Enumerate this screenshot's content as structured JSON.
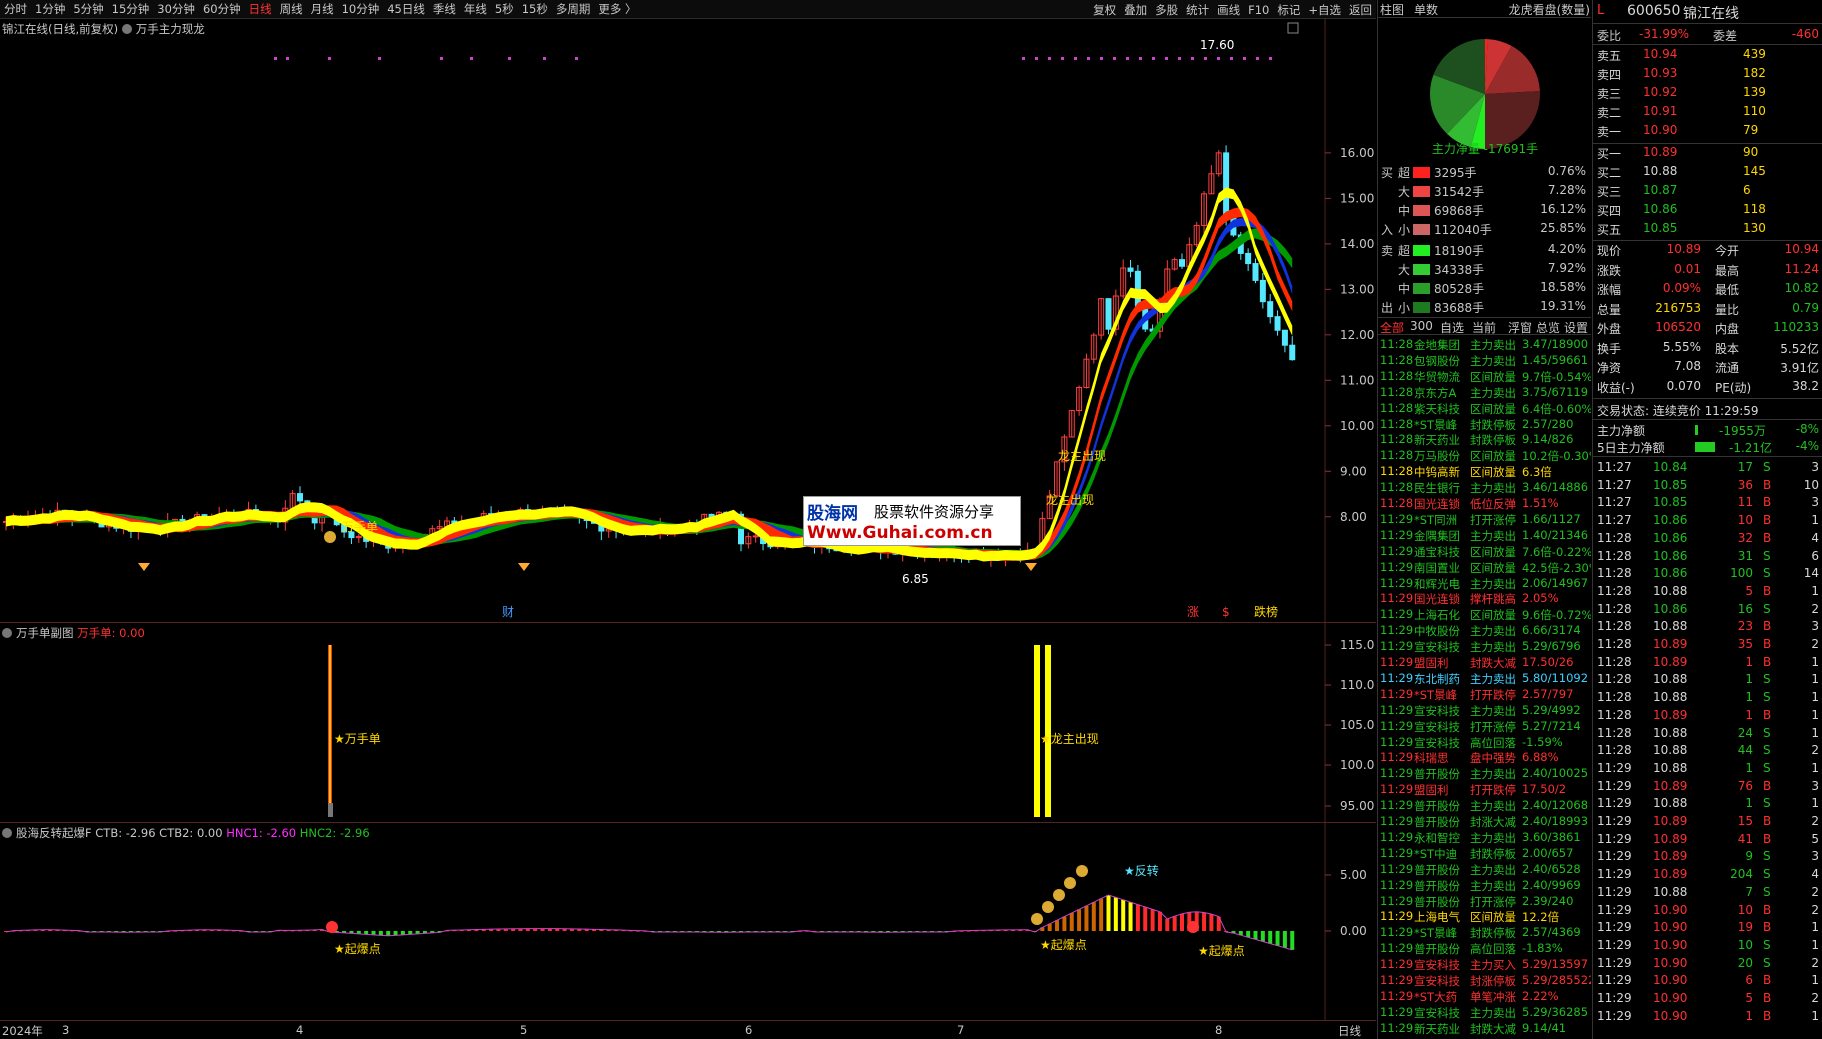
{
  "tabs": {
    "period_tabs": [
      "分时",
      "1分钟",
      "5分钟",
      "15分钟",
      "30分钟",
      "60分钟",
      "日线",
      "周线",
      "月线",
      "10分钟",
      "45日线",
      "季线",
      "年线",
      "5秒",
      "15秒",
      "多周期",
      "更多 〉"
    ],
    "active": "日线",
    "right_tabs": [
      "复权",
      "叠加",
      "多股",
      "统计",
      "画线",
      "F10",
      "标记",
      "+自选",
      "返回"
    ]
  },
  "chart": {
    "title": "锦江在线(日线,前复权)",
    "indicator": "万手主力现龙",
    "price_ticks": [
      "16.00",
      "15.00",
      "14.00",
      "13.00",
      "12.00",
      "11.00",
      "10.00",
      "9.00",
      "8.00"
    ],
    "high_label": "17.60",
    "low_label": "6.85",
    "annotations": {
      "wanshou": "万手单",
      "longzhu1": "龙主出现",
      "longzhu2": "龙主出现",
      "cai": "财",
      "zhang": "涨",
      "s": "$",
      "dieting": "跌榜"
    }
  },
  "sub1": {
    "title": "万手单副图",
    "value_label": "万手单: 0.00",
    "ticks": [
      "115.0",
      "110.0",
      "105.0",
      "100.0",
      "95.00"
    ],
    "ann1": "★万手单",
    "ann2": "★龙主出现"
  },
  "sub2": {
    "title": "股海反转起爆F",
    "ctb": "CTB: -2.96",
    "ctb2": "CTB2: 0.00",
    "hnc1": "HNC1: -2.60",
    "hnc2": "HNC2: -2.96",
    "ticks": [
      "5.00",
      "0.00",
      "-5.00"
    ],
    "ann_qb": "★起爆点",
    "ann_fz": "★反转"
  },
  "x_axis": {
    "labels": [
      "2024年",
      "3",
      "4",
      "5",
      "6",
      "7",
      "8"
    ],
    "mode": "日线"
  },
  "watermark": {
    "line1": "股海网",
    "line2": "股票软件资源分享",
    "line3": "Www.Guhai.com.cn"
  },
  "longhu": {
    "tab1": "柱图",
    "tab2": "单数",
    "title": "龙虎看盘(数量)",
    "net": "主力净量 -17691手",
    "buy": [
      {
        "side": "买",
        "k": "超",
        "v": "3295手",
        "p": "0.76%"
      },
      {
        "side": "",
        "k": "大",
        "v": "31542手",
        "p": "7.28%"
      },
      {
        "side": "",
        "k": "中",
        "v": "69868手",
        "p": "16.12%"
      },
      {
        "side": "入",
        "k": "小",
        "v": "112040手",
        "p": "25.85%"
      }
    ],
    "sell": [
      {
        "side": "卖",
        "k": "超",
        "v": "18190手",
        "p": "4.20%"
      },
      {
        "side": "",
        "k": "大",
        "v": "34338手",
        "p": "7.92%"
      },
      {
        "side": "",
        "k": "中",
        "v": "80528手",
        "p": "18.58%"
      },
      {
        "side": "出",
        "k": "小",
        "v": "83688手",
        "p": "19.31%"
      }
    ]
  },
  "radar": {
    "tabs": [
      "全部",
      "300",
      "自选",
      "当前"
    ],
    "right": [
      "浮窗",
      "总览",
      "设置"
    ],
    "rows": [
      [
        "11:28",
        "金地集团",
        "主力卖出",
        "3.47/18900",
        "w"
      ],
      [
        "11:28",
        "包钢股份",
        "主力卖出",
        "1.45/59661",
        "w"
      ],
      [
        "11:28",
        "华贸物流",
        "区间放量",
        "9.7倍-0.54%",
        "w"
      ],
      [
        "11:28",
        "京东方A",
        "主力卖出",
        "3.75/67119",
        "w"
      ],
      [
        "11:28",
        "紫天科技",
        "区间放量",
        "6.4倍-0.60%",
        "w"
      ],
      [
        "11:28",
        "*ST景峰",
        "封跌停板",
        "2.57/280",
        "w"
      ],
      [
        "11:28",
        "新天药业",
        "封跌停板",
        "9.14/826",
        "w"
      ],
      [
        "11:28",
        "万马股份",
        "区间放量",
        "10.2倍-0.30%",
        "w"
      ],
      [
        "11:28",
        "中钨高新",
        "区间放量",
        "6.3倍",
        "y"
      ],
      [
        "11:28",
        "民生银行",
        "主力卖出",
        "3.46/14886",
        "w"
      ],
      [
        "11:28",
        "国光连锁",
        "低位反弹",
        "1.51%",
        "r"
      ],
      [
        "11:29",
        "*ST同洲",
        "打开涨停",
        "1.66/1127",
        "w"
      ],
      [
        "11:29",
        "金隅集团",
        "主力卖出",
        "1.40/21346",
        "w"
      ],
      [
        "11:29",
        "通宝科技",
        "区间放量",
        "7.6倍-0.22%",
        "w"
      ],
      [
        "11:29",
        "南国置业",
        "区间放量",
        "42.5倍-2.30%",
        "w"
      ],
      [
        "11:29",
        "和辉光电",
        "主力卖出",
        "2.06/14967",
        "w"
      ],
      [
        "11:29",
        "国光连锁",
        "撑杆跳高",
        "2.05%",
        "r"
      ],
      [
        "11:29",
        "上海石化",
        "区间放量",
        "9.6倍-0.72%",
        "w"
      ],
      [
        "11:29",
        "中牧股份",
        "主力卖出",
        "6.66/3174",
        "w"
      ],
      [
        "11:29",
        "宣安科技",
        "主力卖出",
        "5.29/6796",
        "w"
      ],
      [
        "11:29",
        "盟固利",
        "封跌大减",
        "17.50/26",
        "r"
      ],
      [
        "11:29",
        "东北制药",
        "主力卖出",
        "5.80/11092",
        "c"
      ],
      [
        "11:29",
        "*ST景峰",
        "打开跌停",
        "2.57/797",
        "r"
      ],
      [
        "11:29",
        "宣安科技",
        "主力卖出",
        "5.29/4992",
        "w"
      ],
      [
        "11:29",
        "宣安科技",
        "打开涨停",
        "5.27/7214",
        "w"
      ],
      [
        "11:29",
        "宣安科技",
        "高位回落",
        "-1.59%",
        "w"
      ],
      [
        "11:29",
        "科瑞思",
        "盘中强势",
        "6.88%",
        "r"
      ],
      [
        "11:29",
        "普开股份",
        "主力卖出",
        "2.40/10025",
        "w"
      ],
      [
        "11:29",
        "盟固利",
        "打开跌停",
        "17.50/2",
        "r"
      ],
      [
        "11:29",
        "普开股份",
        "主力卖出",
        "2.40/12068",
        "w"
      ],
      [
        "11:29",
        "普开股份",
        "封涨大减",
        "2.40/18993",
        "w"
      ],
      [
        "11:29",
        "永和智控",
        "主力卖出",
        "3.60/3861",
        "w"
      ],
      [
        "11:29",
        "*ST中迪",
        "封跌停板",
        "2.00/657",
        "w"
      ],
      [
        "11:29",
        "普开股份",
        "主力卖出",
        "2.40/6528",
        "w"
      ],
      [
        "11:29",
        "普开股份",
        "主力卖出",
        "2.40/9969",
        "w"
      ],
      [
        "11:29",
        "普开股份",
        "打开涨停",
        "2.39/240",
        "w"
      ],
      [
        "11:29",
        "上海电气",
        "区间放量",
        "12.2倍",
        "y"
      ],
      [
        "11:29",
        "*ST景峰",
        "封跌停板",
        "2.57/4369",
        "w"
      ],
      [
        "11:29",
        "普开股份",
        "高位回落",
        "-1.83%",
        "w"
      ],
      [
        "11:29",
        "宣安科技",
        "主力买入",
        "5.29/13597",
        "r"
      ],
      [
        "11:29",
        "宣安科技",
        "封涨停板",
        "5.29/285522",
        "r"
      ],
      [
        "11:29",
        "*ST大药",
        "单笔冲涨",
        "2.22%",
        "r"
      ],
      [
        "11:29",
        "宣安科技",
        "主力卖出",
        "5.29/36285",
        "w"
      ],
      [
        "11:29",
        "新天药业",
        "封跌大减",
        "9.14/41",
        "w"
      ]
    ]
  },
  "quote": {
    "code": "600650",
    "name": "锦江在线",
    "wb": "-31.99%",
    "wc": "-460",
    "asks": [
      [
        "卖五",
        "10.94",
        "439"
      ],
      [
        "卖四",
        "10.93",
        "182"
      ],
      [
        "卖三",
        "10.92",
        "139"
      ],
      [
        "卖二",
        "10.91",
        "110"
      ],
      [
        "卖一",
        "10.90",
        "79"
      ]
    ],
    "bids": [
      [
        "买一",
        "10.89",
        "90"
      ],
      [
        "买二",
        "10.88",
        "145"
      ],
      [
        "买三",
        "10.87",
        "6"
      ],
      [
        "买四",
        "10.86",
        "118"
      ],
      [
        "买五",
        "10.85",
        "130"
      ]
    ],
    "stats": [
      [
        "现价",
        "10.89",
        "r",
        "今开",
        "10.94",
        "r"
      ],
      [
        "涨跌",
        "0.01",
        "r",
        "最高",
        "11.24",
        "r"
      ],
      [
        "涨幅",
        "0.09%",
        "r",
        "最低",
        "10.82",
        "g"
      ],
      [
        "总量",
        "216753",
        "y",
        "量比",
        "0.79",
        "g"
      ],
      [
        "外盘",
        "106520",
        "r",
        "内盘",
        "110233",
        "g"
      ],
      [
        "换手",
        "5.55%",
        "w",
        "股本",
        "5.52亿",
        "w"
      ],
      [
        "净资",
        "7.08",
        "w",
        "流通",
        "3.91亿",
        "w"
      ],
      [
        "收益(-)",
        "0.070",
        "w",
        "PE(动)",
        "38.2",
        "w"
      ]
    ],
    "status": "交易状态: 连续竞价 11:29:59",
    "main_net": [
      "主力净额",
      "-1955万",
      "-8%"
    ],
    "main_net5": [
      "5日主力净额",
      "-1.21亿",
      "-4%"
    ],
    "ticks": [
      [
        "11:27",
        "10.84",
        "17",
        "S",
        "3"
      ],
      [
        "11:27",
        "10.85",
        "36",
        "B",
        "10"
      ],
      [
        "11:27",
        "10.85",
        "11",
        "B",
        "3"
      ],
      [
        "11:27",
        "10.86",
        "10",
        "B",
        "1"
      ],
      [
        "11:28",
        "10.86",
        "32",
        "B",
        "4"
      ],
      [
        "11:28",
        "10.86",
        "31",
        "S",
        "6"
      ],
      [
        "11:28",
        "10.86",
        "100",
        "S",
        "14"
      ],
      [
        "11:28",
        "10.88",
        "5",
        "B",
        "1"
      ],
      [
        "11:28",
        "10.86",
        "16",
        "S",
        "2"
      ],
      [
        "11:28",
        "10.88",
        "23",
        "B",
        "3"
      ],
      [
        "11:28",
        "10.89",
        "35",
        "B",
        "2"
      ],
      [
        "11:28",
        "10.89",
        "1",
        "B",
        "1"
      ],
      [
        "11:28",
        "10.88",
        "1",
        "S",
        "1"
      ],
      [
        "11:28",
        "10.88",
        "1",
        "S",
        "1"
      ],
      [
        "11:28",
        "10.89",
        "1",
        "B",
        "1"
      ],
      [
        "11:28",
        "10.88",
        "24",
        "S",
        "1"
      ],
      [
        "11:28",
        "10.88",
        "44",
        "S",
        "2"
      ],
      [
        "11:29",
        "10.88",
        "1",
        "S",
        "1"
      ],
      [
        "11:29",
        "10.89",
        "76",
        "B",
        "3"
      ],
      [
        "11:29",
        "10.88",
        "1",
        "S",
        "1"
      ],
      [
        "11:29",
        "10.89",
        "15",
        "B",
        "2"
      ],
      [
        "11:29",
        "10.89",
        "41",
        "B",
        "5"
      ],
      [
        "11:29",
        "10.89",
        "9",
        "S",
        "3"
      ],
      [
        "11:29",
        "10.89",
        "204",
        "S",
        "4"
      ],
      [
        "11:29",
        "10.88",
        "7",
        "S",
        "2"
      ],
      [
        "11:29",
        "10.90",
        "10",
        "B",
        "2"
      ],
      [
        "11:29",
        "10.90",
        "19",
        "B",
        "1"
      ],
      [
        "11:29",
        "10.90",
        "10",
        "S",
        "1"
      ],
      [
        "11:29",
        "10.90",
        "20",
        "S",
        "2"
      ],
      [
        "11:29",
        "10.90",
        "6",
        "B",
        "1"
      ],
      [
        "11:29",
        "10.90",
        "5",
        "B",
        "2"
      ],
      [
        "11:29",
        "10.90",
        "1",
        "B",
        "1"
      ]
    ]
  }
}
